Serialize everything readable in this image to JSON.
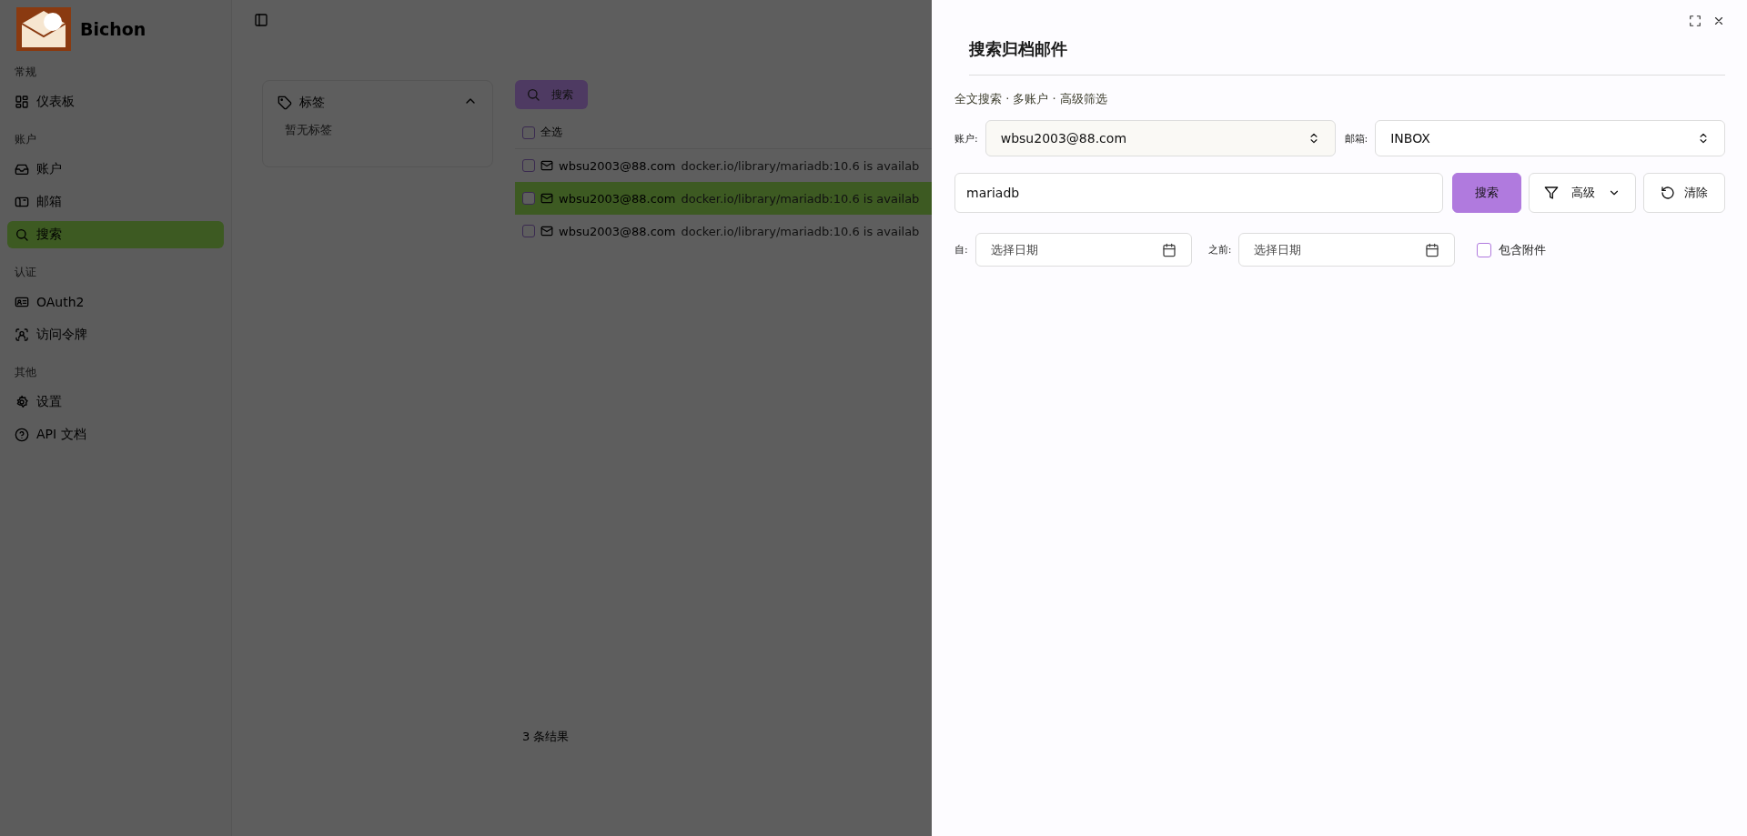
{
  "sidebar": {
    "app_name": "Bichon",
    "sections": [
      {
        "label": "常规",
        "items": [
          {
            "label": "仪表板",
            "selected": false
          }
        ]
      },
      {
        "label": "账户",
        "items": [
          {
            "label": "账户",
            "selected": false
          },
          {
            "label": "邮箱",
            "selected": false
          },
          {
            "label": "搜索",
            "selected": true
          }
        ]
      },
      {
        "label": "认证",
        "items": [
          {
            "label": "OAuth2",
            "selected": false
          },
          {
            "label": "访问令牌",
            "selected": false
          }
        ]
      },
      {
        "label": "其他",
        "items": [
          {
            "label": "设置",
            "selected": false
          },
          {
            "label": "API 文档",
            "selected": false
          }
        ]
      }
    ]
  },
  "tags_panel": {
    "title": "标签",
    "expanded": true,
    "empty_text": "暂无标签"
  },
  "search_button": "搜索",
  "results": {
    "select_all": {
      "label": "全选",
      "checked": false
    },
    "rows": [
      {
        "sender": "wbsu2003@88.com",
        "subject": "docker.io/library/mariadb:10.6 is availab",
        "checked": false,
        "selected": false
      },
      {
        "sender": "wbsu2003@88.com",
        "subject": "docker.io/library/mariadb:10.6 is availab",
        "checked": false,
        "selected": true
      },
      {
        "sender": "wbsu2003@88.com",
        "subject": "docker.io/library/mariadb:10.6 is availab",
        "checked": false,
        "selected": false
      }
    ],
    "count": "3 条结果"
  },
  "drawer": {
    "title": "搜索归档邮件",
    "subtitle": "全文搜索 · 多账户 · 高级筛选",
    "account": {
      "label": "账户:",
      "value": "wbsu2003@88.com"
    },
    "mailbox": {
      "label": "邮箱:",
      "value": "INBOX"
    },
    "query": {
      "value": "mariadb"
    },
    "buttons": [
      {
        "label": "搜索",
        "kind": "primary"
      },
      {
        "label": "高级",
        "kind": "dropdown"
      },
      {
        "label": "清除",
        "kind": "reset"
      }
    ],
    "from": {
      "label": "自:",
      "placeholder": "选择日期"
    },
    "before": {
      "label": "之前:",
      "placeholder": "选择日期"
    },
    "attachments": {
      "label": "包含附件",
      "checked": false
    }
  }
}
